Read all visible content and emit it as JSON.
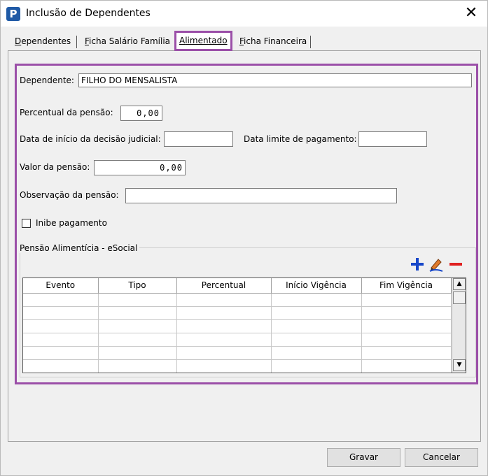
{
  "window": {
    "title": "Inclusão de Dependentes",
    "app_icon": "P",
    "close_glyph": "✕"
  },
  "tabs": [
    {
      "label": "Dependentes"
    },
    {
      "label": "Ficha Salário Família"
    },
    {
      "label": "Alimentado"
    },
    {
      "label": "Ficha Financeira"
    }
  ],
  "active_tab": "Alimentado",
  "form": {
    "dependente_label": "Dependente:",
    "dependente_value": "FILHO DO MENSALISTA",
    "percentual_label": "Percentual da pensão:",
    "percentual_value": "0,00",
    "data_inicio_label": "Data de início da decisão judicial:",
    "data_inicio_value": "",
    "data_limite_label": "Data limite de pagamento:",
    "data_limite_value": "",
    "valor_label": "Valor da pensão:",
    "valor_value": "0,00",
    "observacao_label": "Observação da pensão:",
    "observacao_value": "",
    "inibe_label": "Inibe pagamento",
    "inibe_checked": false
  },
  "esocial": {
    "group_title": "Pensão Alimentícia - eSocial",
    "columns": [
      "Evento",
      "Tipo",
      "Percentual",
      "Início Vigência",
      "Fim Vigência"
    ],
    "row_count": 6
  },
  "buttons": {
    "save": "Gravar",
    "cancel": "Cancelar"
  },
  "colors": {
    "highlight": "#9b4fa8",
    "add_icon": "#1747c9",
    "remove_icon": "#e02020",
    "app_icon_bg": "#1f5aa6"
  },
  "icons": {
    "add": "plus-icon",
    "edit": "pencil-icon",
    "remove": "minus-icon"
  }
}
